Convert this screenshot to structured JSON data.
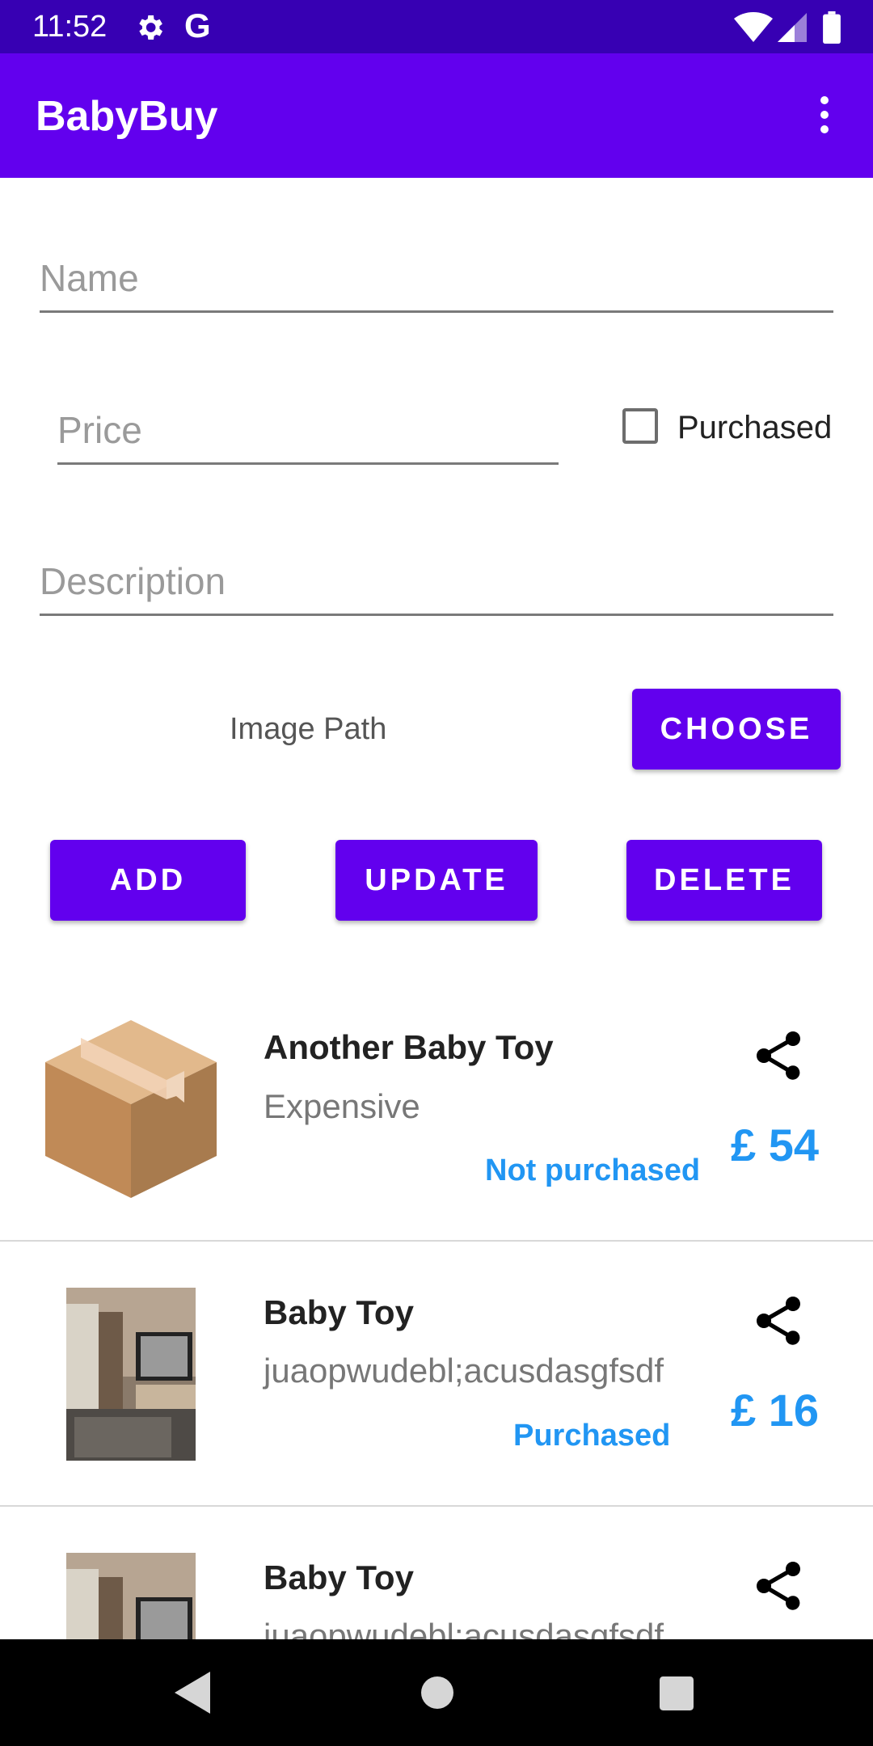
{
  "status_bar": {
    "time": "11:52",
    "g_letter": "G"
  },
  "app_bar": {
    "title": "BabyBuy"
  },
  "form": {
    "name_placeholder": "Name",
    "price_placeholder": "Price",
    "purchased_label": "Purchased",
    "purchased_checked": false,
    "description_placeholder": "Description",
    "image_path_label": "Image Path",
    "choose_label": "CHOOSE",
    "add_label": "ADD",
    "update_label": "UPDATE",
    "delete_label": "DELETE"
  },
  "items": [
    {
      "title": "Another Baby Toy",
      "description": "Expensive",
      "status": "Not purchased",
      "price": "£ 54",
      "thumbnail": "box-icon"
    },
    {
      "title": "Baby Toy",
      "description": "juaopwudebl;acusdasgfsdf",
      "status": "Purchased",
      "price": "£ 16",
      "thumbnail": "room-photo"
    },
    {
      "title": "Baby Toy",
      "description": "juaopwudebl;acusdasgfsdf",
      "status": "",
      "price": "",
      "thumbnail": "room-photo"
    }
  ],
  "colors": {
    "primary": "#6200ee",
    "primary_dark": "#3700b3",
    "accent": "#2196f3"
  }
}
